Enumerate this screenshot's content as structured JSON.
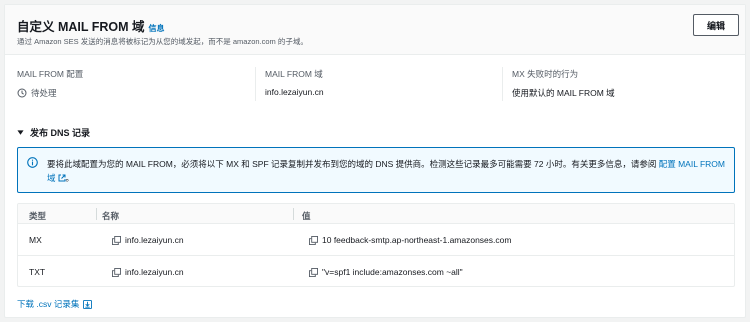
{
  "header": {
    "title": "自定义 MAIL FROM 域",
    "info_label": "信息",
    "subtitle": "通过 Amazon SES 发送的消息将被标记为从您的域发起，而不是 amazon.com 的子域。",
    "edit_label": "编辑"
  },
  "details": [
    {
      "label": "MAIL FROM 配置",
      "value": "待处理",
      "icon": "pending-clock-icon"
    },
    {
      "label": "MAIL FROM 域",
      "value": "info.lezaiyun.cn"
    },
    {
      "label": "MX 失败时的行为",
      "value": "使用默认的 MAIL FROM 域"
    }
  ],
  "dns_section": {
    "title": "发布 DNS 记录",
    "expanded": true,
    "alert": {
      "text": "要将此域配置为您的 MAIL FROM，必须将以下 MX 和 SPF 记录复制并发布到您的域的 DNS 提供商。检测这些记录最多可能需要 72 小时。有关更多信息，请参阅",
      "link_label": "配置 MAIL FROM 域"
    },
    "table": {
      "columns": [
        "类型",
        "名称",
        "值"
      ],
      "rows": [
        {
          "type": "MX",
          "name": "info.lezaiyun.cn",
          "value": "10 feedback-smtp.ap-northeast-1.amazonses.com"
        },
        {
          "type": "TXT",
          "name": "info.lezaiyun.cn",
          "value": "\"v=spf1 include:amazonses.com ~all\""
        }
      ]
    },
    "download_label": "下载 .csv 记录集"
  },
  "colors": {
    "link": "#0073bb",
    "alert_background": "#f1faff",
    "alert_border": "#0073bb",
    "text_primary": "#16191f",
    "text_secondary": "#545b64"
  }
}
